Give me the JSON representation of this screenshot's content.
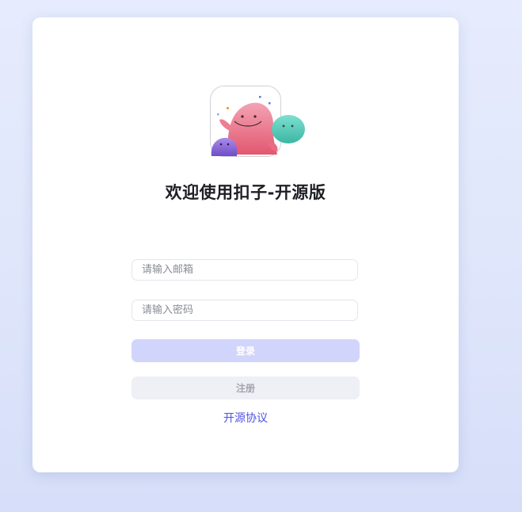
{
  "login_card": {
    "title": "欢迎使用扣子-开源版",
    "email_placeholder": "请输入邮箱",
    "password_placeholder": "请输入密码",
    "login_label": "登录",
    "register_label": "注册",
    "license_link": "开源协议"
  },
  "colors": {
    "accent": "#5050e6",
    "login_button_bg": "#d2d5fb",
    "register_button_bg": "#eff0f5"
  },
  "icons": {
    "logo": "mascot-logo-icon"
  }
}
